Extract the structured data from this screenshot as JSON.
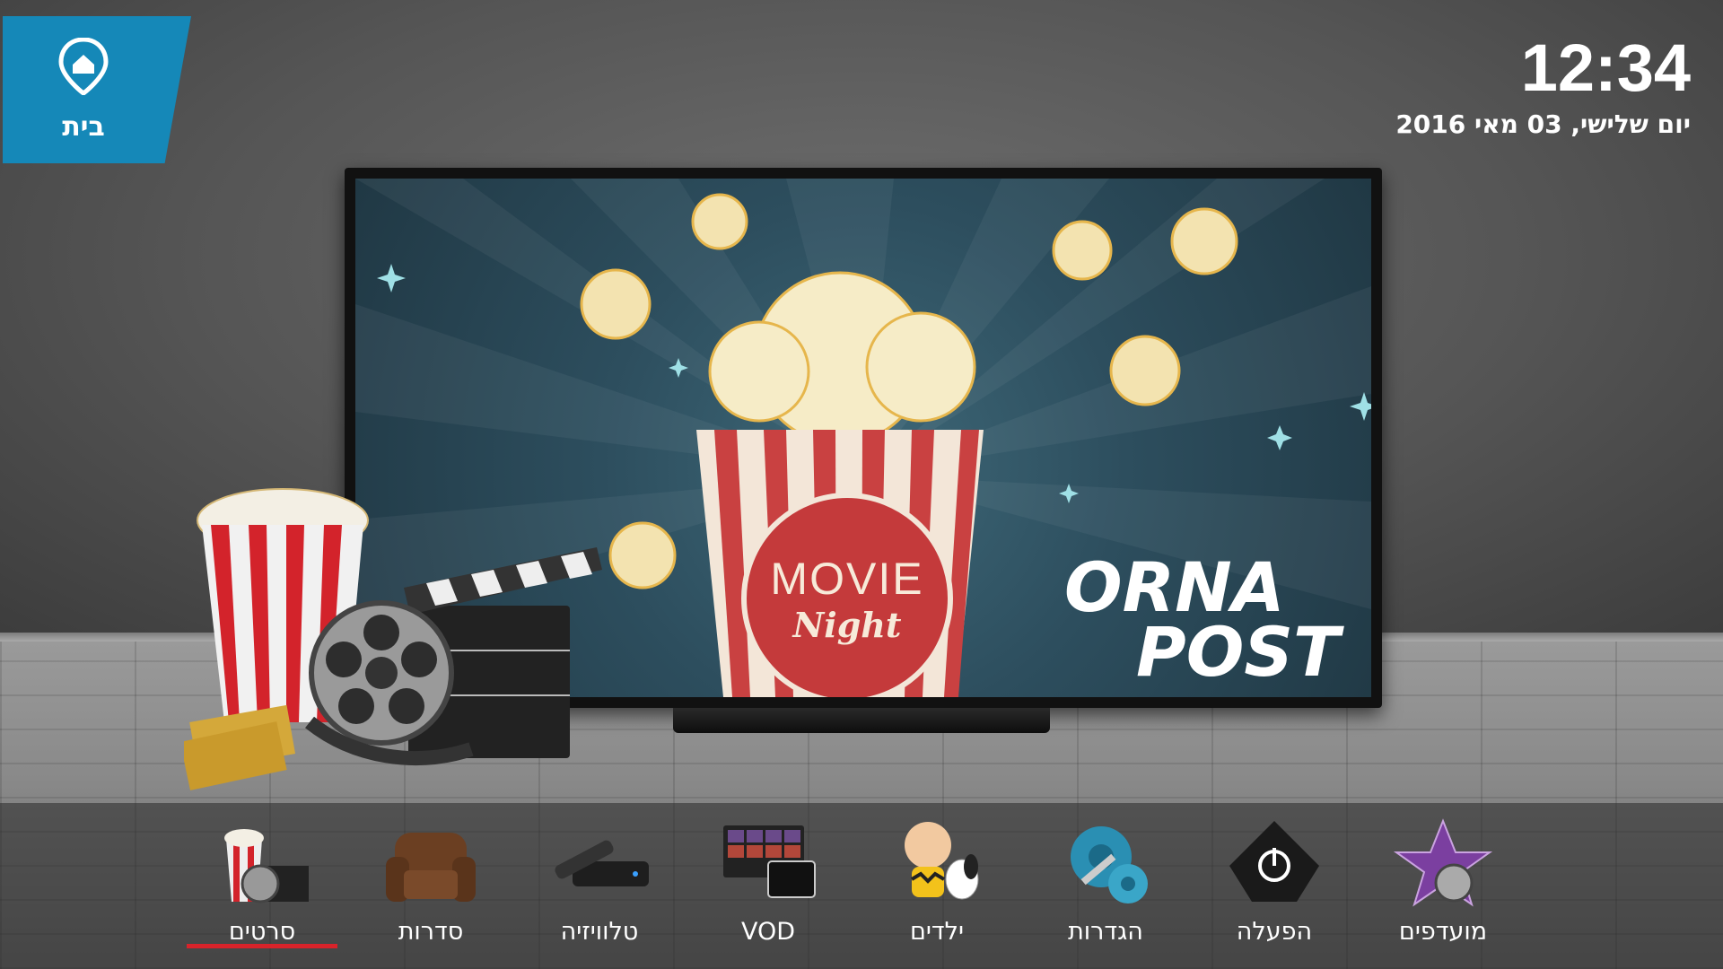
{
  "home": {
    "label": "בית",
    "icon": "home-pin-icon"
  },
  "clock": {
    "time": "12:34",
    "date": "יום שלישי, 03 מאי 2016"
  },
  "hero": {
    "movie_word": "MOVIE",
    "night_word": "Night",
    "brand_line1": "ORNA",
    "brand_line2": "POST"
  },
  "menu": {
    "selected_index": 0,
    "accent_color": "#d8232a",
    "items": [
      {
        "label": "סרטים",
        "icon": "movies-icon"
      },
      {
        "label": "סדרות",
        "icon": "armchair-icon"
      },
      {
        "label": "טלוויזיה",
        "icon": "tv-box-remote-icon"
      },
      {
        "label": "VOD",
        "icon": "vod-screens-icon"
      },
      {
        "label": "ילדים",
        "icon": "kids-character-icon"
      },
      {
        "label": "הגדרות",
        "icon": "settings-gears-icon"
      },
      {
        "label": "הפעלה",
        "icon": "power-icon"
      },
      {
        "label": "מועדפים",
        "icon": "favorites-star-icon"
      }
    ]
  },
  "colors": {
    "home_badge": "#1588b8",
    "tv_screen": "#2d4e5e",
    "circle": "#c43a3b"
  }
}
